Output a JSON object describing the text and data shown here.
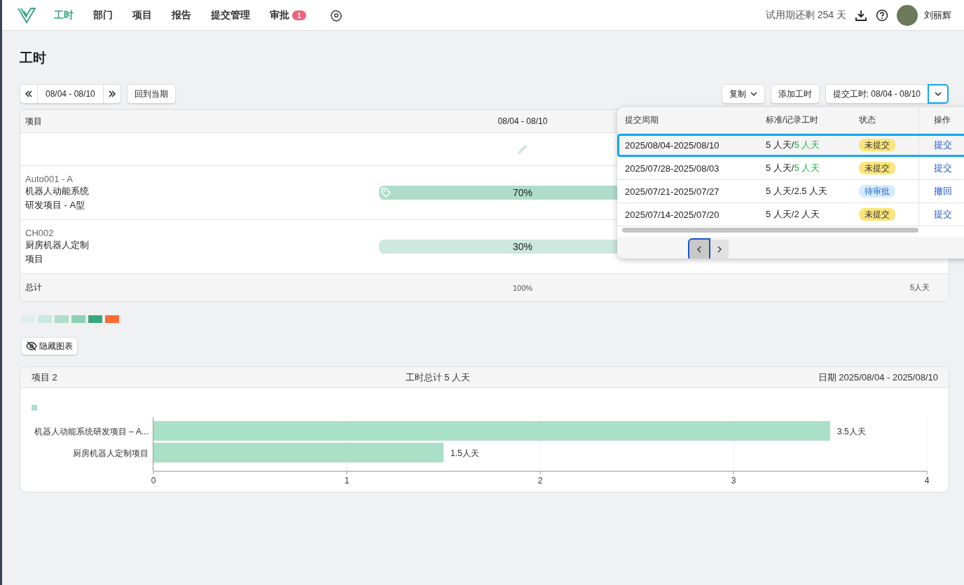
{
  "nav": {
    "tabs": [
      {
        "label": "工时",
        "selected": true
      },
      {
        "label": "部门",
        "selected": false
      },
      {
        "label": "项目",
        "selected": false
      },
      {
        "label": "报告",
        "selected": false
      },
      {
        "label": "提交管理",
        "selected": false
      },
      {
        "label": "审批",
        "selected": false,
        "badge": "1"
      }
    ],
    "trial": "试用期还剩 254 天",
    "user": "刘丽辉"
  },
  "page_title": "工时",
  "toolbar": {
    "period": "08/04 - 08/10",
    "current": "回到当期",
    "copy": "复制",
    "add": "添加工时",
    "submit": "提交工时: 08/04 - 08/10",
    "submit_expanded": true
  },
  "table": {
    "columns": [
      "项目",
      "08/04 - 08/10"
    ],
    "rows": [
      {
        "code": "Auto001 - A",
        "name": [
          "机器人动能系统",
          "研发项目 - A型"
        ],
        "share": "70%",
        "color": "#b0dccb",
        "tag": true
      },
      {
        "code": "CH002",
        "name": [
          "厨房机器人定制",
          "项目"
        ],
        "share": "30%",
        "color": "#cde8de",
        "tag": false
      }
    ],
    "footer": {
      "label": "总计",
      "share": "100%",
      "total": "5人天"
    }
  },
  "legend": [
    {
      "color": "#e0eeea"
    },
    {
      "color": "#cde8de"
    },
    {
      "color": "#b0dccb"
    },
    {
      "color": "#8dd0b3"
    },
    {
      "color": "#3aa67f"
    },
    {
      "color": "#ff6b35"
    }
  ],
  "hide_chart": "隐藏图表",
  "chart_card": {
    "projects": "项目 2",
    "total": "工时总计 5 人天",
    "date": "日期 2025/08/04 - 2025/08/10",
    "chart_data": {
      "type": "bar",
      "orientation": "horizontal",
      "categories": [
        "机器人动能系统研发项目 – A...",
        "厨房机器人定制项目"
      ],
      "series": [
        {
          "color": "#aadfc8",
          "values": [
            3.5,
            1.5
          ]
        }
      ],
      "xlim": [
        0,
        4
      ],
      "grid": true,
      "xticks": [
        0,
        1,
        2,
        3,
        4
      ],
      "value_labels": [
        "3.5人天",
        "1.5人天"
      ]
    }
  },
  "popup": {
    "columns": [
      "提交周期",
      "标准/记录工时",
      "状态",
      "操作"
    ],
    "rows": [
      {
        "period": "2025/08/04-2025/08/10",
        "standard": "5 人天/",
        "recorded": "5 人天",
        "met": true,
        "status": "未提交",
        "kind": "unsubmitted",
        "action": "提交",
        "selected": true
      },
      {
        "period": "2025/07/28-2025/08/03",
        "standard": "5 人天/",
        "recorded": "5 人天",
        "met": true,
        "status": "未提交",
        "kind": "unsubmitted",
        "action": "提交",
        "selected": false
      },
      {
        "period": "2025/07/21-2025/07/27",
        "standard": "5 人天/",
        "recorded": "2.5 人天",
        "met": false,
        "status": "待审批",
        "kind": "review",
        "action": "撤回",
        "selected": false
      },
      {
        "period": "2025/07/14-2025/07/20",
        "standard": "5 人天/",
        "recorded": "2 人天",
        "met": false,
        "status": "未提交",
        "kind": "unsubmitted",
        "action": "提交",
        "selected": false
      }
    ]
  }
}
